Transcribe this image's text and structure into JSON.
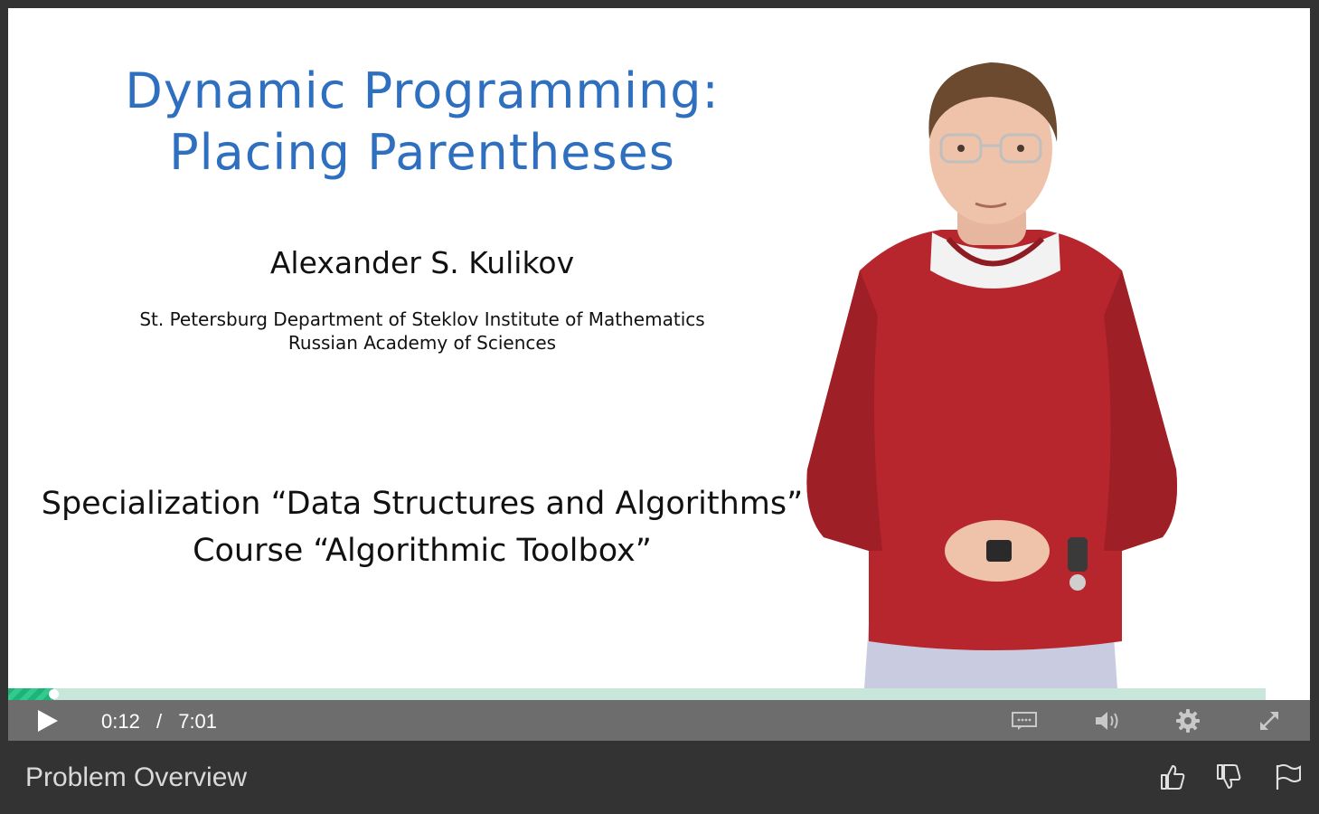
{
  "slide": {
    "title_line1": "Dynamic Programming:",
    "title_line2": "Placing Parentheses",
    "author": "Alexander S. Kulikov",
    "affiliation_line1": "St. Petersburg Department of Steklov Institute of Mathematics",
    "affiliation_line2": "Russian Academy of Sciences",
    "specialization": "Specialization “Data Structures and Algorithms”",
    "course": "Course “Algorithmic Toolbox”"
  },
  "player": {
    "current_time": "0:12",
    "separator": "/",
    "duration": "7:01",
    "progress_fraction": 0.036,
    "icons": {
      "play": "play-icon",
      "captions": "captions-icon",
      "volume": "volume-icon",
      "settings": "gear-icon",
      "fullscreen": "fullscreen-icon"
    }
  },
  "footer": {
    "lesson_title": "Problem Overview",
    "icons": {
      "like": "thumbs-up-icon",
      "dislike": "thumbs-down-icon",
      "flag": "flag-icon"
    }
  },
  "colors": {
    "slide_title": "#2e6fc0",
    "progress": "#1bb57a",
    "progress_track": "#c8e6d9",
    "control_bar": "#6d6d6d",
    "background": "#333333"
  }
}
